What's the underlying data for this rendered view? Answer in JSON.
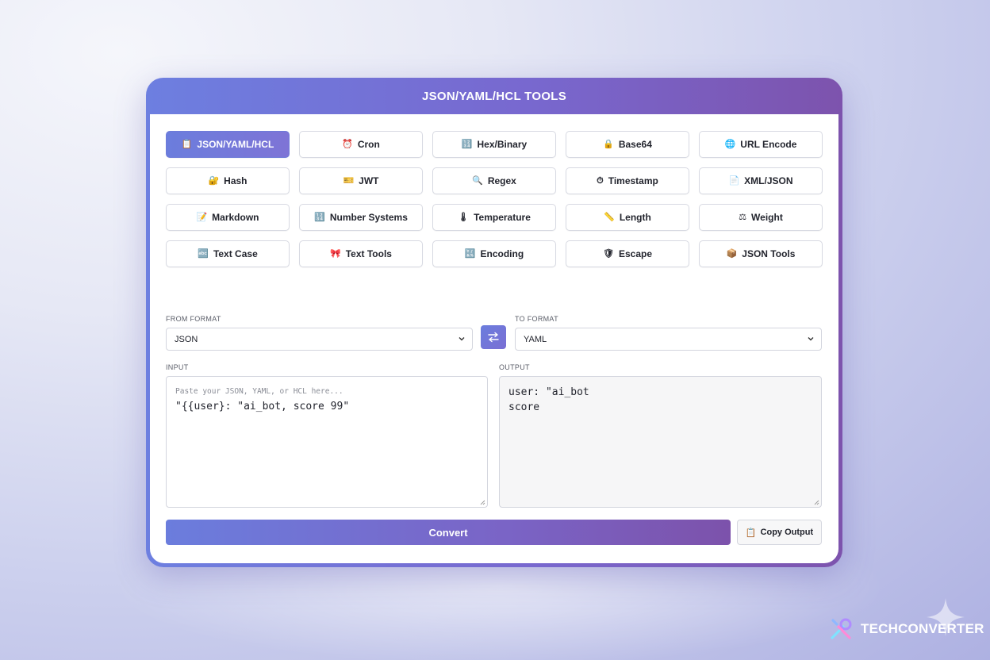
{
  "window": {
    "title": "JSON/YAML/HCL TOOLS"
  },
  "tools": [
    {
      "icon": "📋",
      "label": "JSON/YAML/HCL",
      "active": true
    },
    {
      "icon": "⏰",
      "label": "Cron"
    },
    {
      "icon": "🔢",
      "label": "Hex/Binary"
    },
    {
      "icon": "🔒",
      "label": "Base64"
    },
    {
      "icon": "🌐",
      "label": "URL Encode"
    },
    {
      "icon": "🔐",
      "label": "Hash"
    },
    {
      "icon": "🎫",
      "label": "JWT"
    },
    {
      "icon": "🔍",
      "label": "Regex"
    },
    {
      "icon": "⏱",
      "label": "Timestamp"
    },
    {
      "icon": "📄",
      "label": "XML/JSON"
    },
    {
      "icon": "📝",
      "label": "Markdown"
    },
    {
      "icon": "🔢",
      "label": "Number Systems"
    },
    {
      "icon": "🌡",
      "label": "Temperature"
    },
    {
      "icon": "📏",
      "label": "Length"
    },
    {
      "icon": "⚖",
      "label": "Weight"
    },
    {
      "icon": "🔤",
      "label": "Text Case"
    },
    {
      "icon": "🎀",
      "label": "Text Tools"
    },
    {
      "icon": "🔣",
      "label": "Encoding"
    },
    {
      "icon": "🛡",
      "label": "Escape"
    },
    {
      "icon": "📦",
      "label": "JSON Tools"
    }
  ],
  "from": {
    "label": "FROM FORMAT",
    "value": "JSON"
  },
  "to": {
    "label": "TO FORMAT",
    "value": "YAML"
  },
  "input": {
    "label": "INPUT",
    "placeholder": "Paste your JSON, YAML, or HCL here...",
    "value": "\"{{user}: \"ai_bot, score 99\""
  },
  "output": {
    "label": "OUTPUT",
    "lines": [
      "user: \"ai_bot",
      "score"
    ]
  },
  "actions": {
    "convert": "Convert",
    "copy_icon": "📋",
    "copy": "Copy Output"
  },
  "brand": {
    "name": "TECHCONVERTER"
  },
  "colors": {
    "accent_start": "#6b7ddd",
    "accent_end": "#7c52ab"
  }
}
